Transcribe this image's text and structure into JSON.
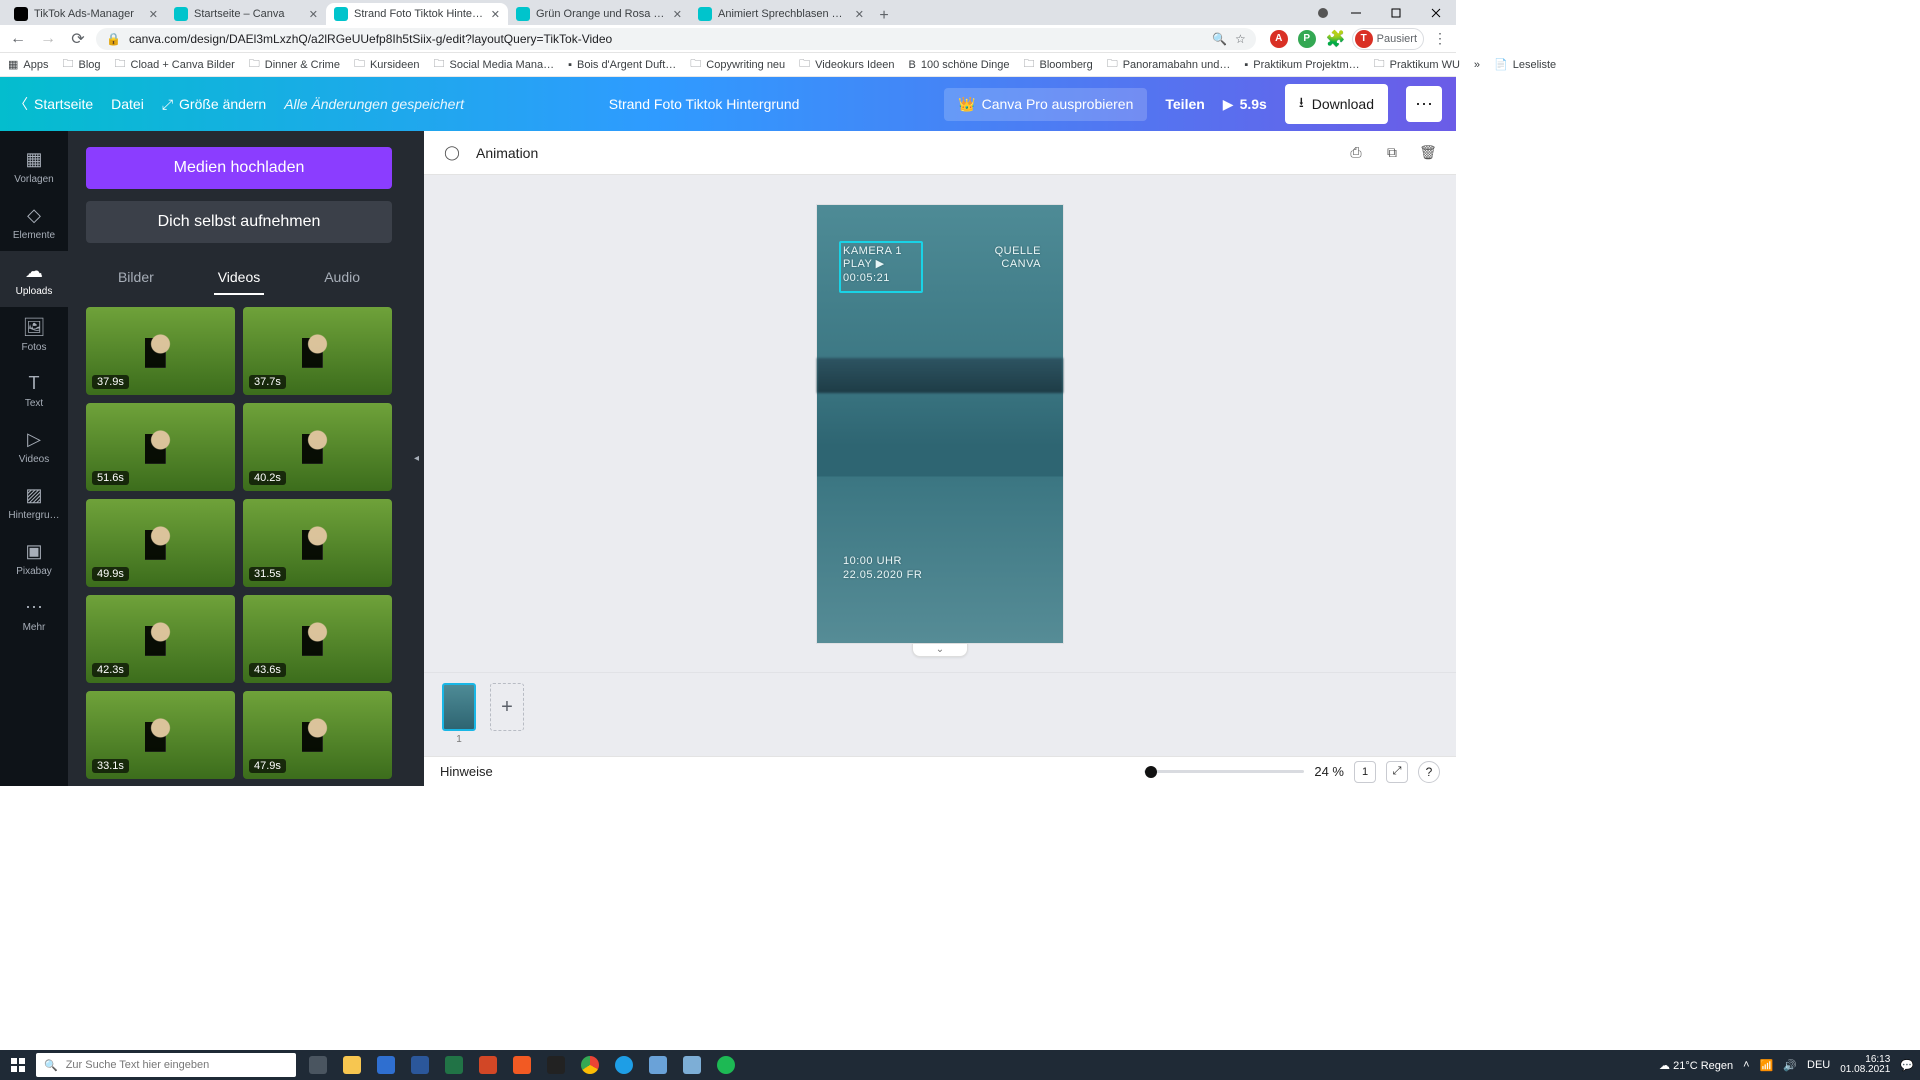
{
  "browser": {
    "tabs": [
      {
        "label": "TikTok Ads-Manager",
        "fav": "#000"
      },
      {
        "label": "Startseite – Canva",
        "fav": "#00c4cc"
      },
      {
        "label": "Strand Foto Tiktok Hintergrund –",
        "fav": "#00c4cc"
      },
      {
        "label": "Grün Orange und Rosa Organisc",
        "fav": "#00c4cc"
      },
      {
        "label": "Animiert Sprechblasen Tiktok-Hi",
        "fav": "#00c4cc"
      }
    ],
    "active_tab": 2,
    "url": "canva.com/design/DAEl3mLxzhQ/a2lRGeUUefp8Ih5tSiix-g/edit?layoutQuery=TikTok-Video",
    "profile_label": "Pausiert",
    "profile_initial": "T"
  },
  "bookmarks": [
    "Apps",
    "Blog",
    "Cload + Canva Bilder",
    "Dinner & Crime",
    "Kursideen",
    "Social Media Mana…",
    "Bois d'Argent Duft…",
    "Copywriting neu",
    "Videokurs Ideen",
    "100 schöne Dinge",
    "Bloomberg",
    "Panoramabahn und…",
    "Praktikum Projektm…",
    "Praktikum WU"
  ],
  "bookmarks_more": "»",
  "reading_list": "Leseliste",
  "canva_top": {
    "home": "Startseite",
    "file": "Datei",
    "resize": "Größe ändern",
    "saved": "Alle Änderungen gespeichert",
    "title": "Strand Foto Tiktok Hintergrund",
    "try_pro": "Canva Pro ausprobieren",
    "share": "Teilen",
    "play_time": "5.9s",
    "download": "Download"
  },
  "rail": [
    {
      "label": "Vorlagen"
    },
    {
      "label": "Elemente"
    },
    {
      "label": "Uploads"
    },
    {
      "label": "Fotos"
    },
    {
      "label": "Text"
    },
    {
      "label": "Videos"
    },
    {
      "label": "Hintergru…"
    },
    {
      "label": "Pixabay"
    },
    {
      "label": "Mehr"
    }
  ],
  "rail_active": 2,
  "panel": {
    "upload": "Medien hochladen",
    "record": "Dich selbst aufnehmen",
    "tabs": {
      "images": "Bilder",
      "videos": "Videos",
      "audio": "Audio"
    },
    "active_tab": "videos",
    "videos": [
      "37.9s",
      "37.7s",
      "51.6s",
      "40.2s",
      "49.9s",
      "31.5s",
      "42.3s",
      "43.6s",
      "33.1s",
      "47.9s",
      "",
      ""
    ]
  },
  "context_bar": {
    "animation": "Animation"
  },
  "canvas_overlay": {
    "camera_line1": "KAMERA 1",
    "camera_line2": "PLAY ▶",
    "camera_line3": "00:05:21",
    "source_line1": "QUELLE",
    "source_line2": "CANVA",
    "time_line1": "10:00 UHR",
    "time_line2": "22.05.2020 FR"
  },
  "timeline": {
    "page_number": "1"
  },
  "notes": {
    "label": "Hinweise"
  },
  "zoom": {
    "value": "24 %",
    "page_badge": "1"
  },
  "taskbar": {
    "search_placeholder": "Zur Suche Text hier eingeben",
    "weather": "21°C  Regen",
    "lang": "DEU",
    "time": "16:13",
    "date": "01.08.2021"
  }
}
